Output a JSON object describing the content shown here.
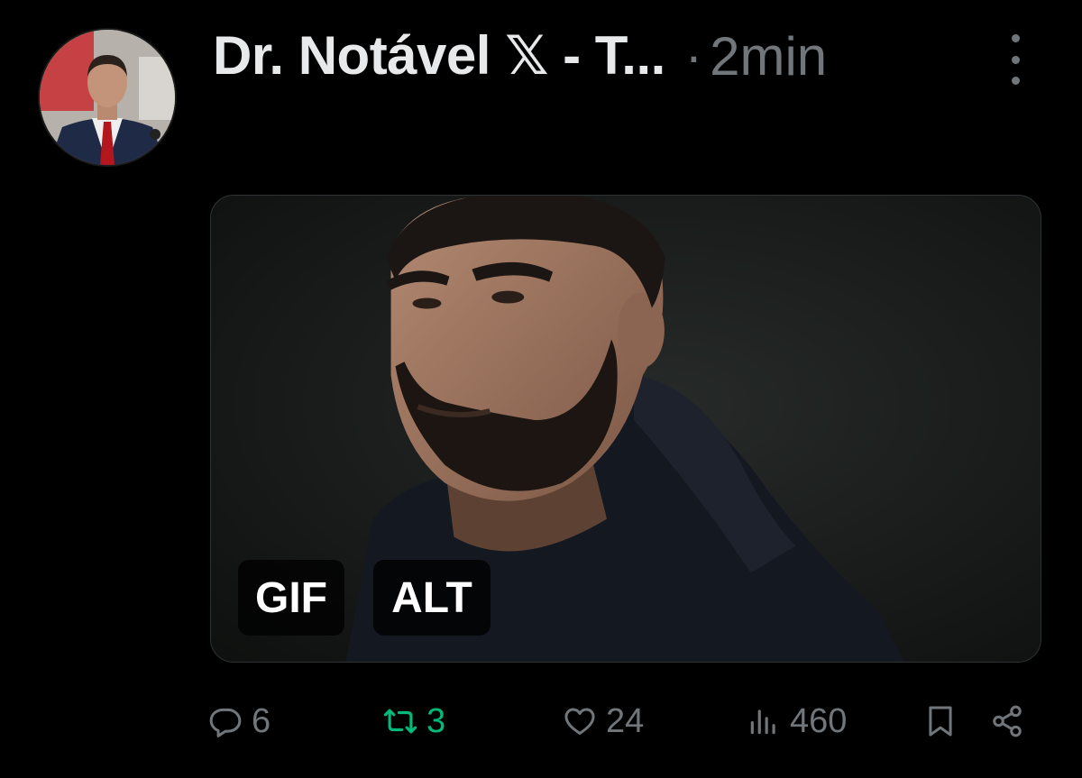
{
  "post": {
    "author_name": "Dr. Notável 𝕏 - T...",
    "separator": "·",
    "timestamp": "2min",
    "media": {
      "badges": {
        "gif": "GIF",
        "alt": "ALT"
      }
    },
    "actions": {
      "replies": "6",
      "reposts": "3",
      "likes": "24",
      "views": "460"
    }
  },
  "colors": {
    "background": "#000000",
    "text_primary": "#e7e9ea",
    "text_secondary": "#71767b",
    "repost_active": "#00ba7c"
  },
  "icons": [
    "more-vertical-icon",
    "reply-icon",
    "repost-icon",
    "like-icon",
    "views-icon",
    "bookmark-icon",
    "share-icon"
  ]
}
